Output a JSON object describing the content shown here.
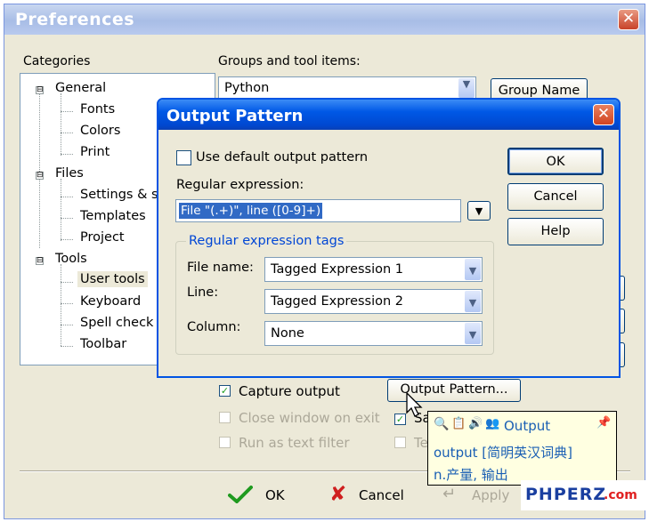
{
  "prefs": {
    "title": "Preferences",
    "categories_label": "Categories",
    "groups_label": "Groups and tool items:",
    "group_combo_value": "Python",
    "group_name_button": "Group Name",
    "tree": [
      {
        "label": "General",
        "expander": "⊟"
      },
      {
        "label": "Fonts"
      },
      {
        "label": "Colors"
      },
      {
        "label": "Print"
      },
      {
        "label": "Files",
        "expander": "⊟"
      },
      {
        "label": "Settings & sy"
      },
      {
        "label": "Templates"
      },
      {
        "label": "Project"
      },
      {
        "label": "Tools",
        "expander": "⊟"
      },
      {
        "label": "User tools"
      },
      {
        "label": "Keyboard"
      },
      {
        "label": "Spell check"
      },
      {
        "label": "Toolbar"
      }
    ],
    "capture_output": "Capture output",
    "close_window": "Close window on exit",
    "run_text_filter": "Run as text filter",
    "save_partial": "Sa",
    "text_partial": "Te",
    "output_pattern_button": "Output Pattern...",
    "ok_button": "OK",
    "cancel_button": "Cancel",
    "apply_button": "Apply"
  },
  "dialog": {
    "title": "Output Pattern",
    "use_default": "Use default output pattern",
    "regex_label": "Regular expression:",
    "regex_value": "File \"(.+)\", line ([0-9]+)",
    "tags_group": "Regular expression tags",
    "file_name_label": "File name:",
    "file_name_value": "Tagged Expression 1",
    "line_label": "Line:",
    "line_value": "Tagged Expression 2",
    "column_label": "Column:",
    "column_value": "None",
    "ok": "OK",
    "cancel": "Cancel",
    "help": "Help"
  },
  "tooltip": {
    "word": "Output",
    "line1": "output [简明英汉词典]",
    "line2": "n.产量, 输出"
  },
  "watermark": "PHPERZ",
  "watermark_suffix": ".com",
  "colors": {
    "accent": "#0054e3",
    "title_inactive": "#a8bde6",
    "watermark": "#1a3fa0"
  }
}
